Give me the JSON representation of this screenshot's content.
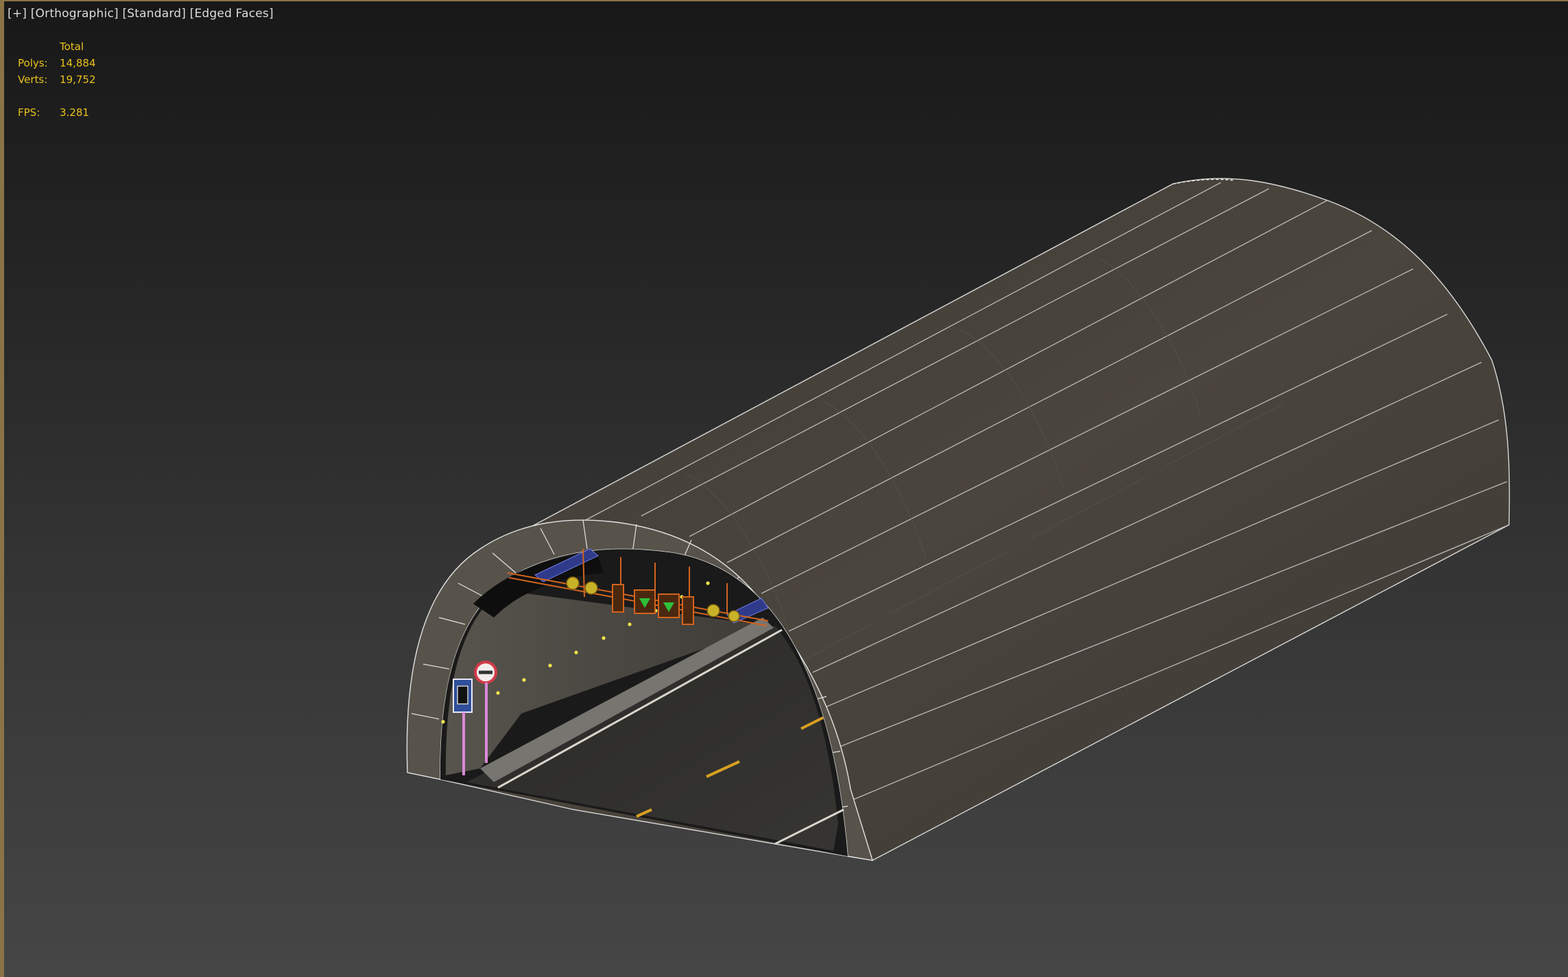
{
  "viewport": {
    "menu_plus": "[+]",
    "view_mode": "[Orthographic]",
    "shading_mode": "[Standard]",
    "edge_mode": "[Edged Faces]"
  },
  "stats": {
    "header": "Total",
    "polys_label": "Polys:",
    "polys_value": "14,884",
    "verts_label": "Verts:",
    "verts_value": "19,752",
    "fps_label": "FPS:",
    "fps_value": "3.281"
  },
  "colors": {
    "stats_text": "#e9c21d",
    "label_text": "#dcdcdc",
    "frame_border": "#8a7344",
    "tunnel_concrete": "#4a453d",
    "wireframe": "#e6e6e6",
    "traffic_frame": "#d2641e",
    "road_line": "#d8a020"
  },
  "scene": {
    "object": "road-tunnel-model",
    "signs": [
      "height-limit-sign-icon",
      "no-overtaking-sign-icon"
    ],
    "traffic_signals": [
      "lane-arrow-green-icon",
      "lane-arrow-green-icon"
    ]
  }
}
